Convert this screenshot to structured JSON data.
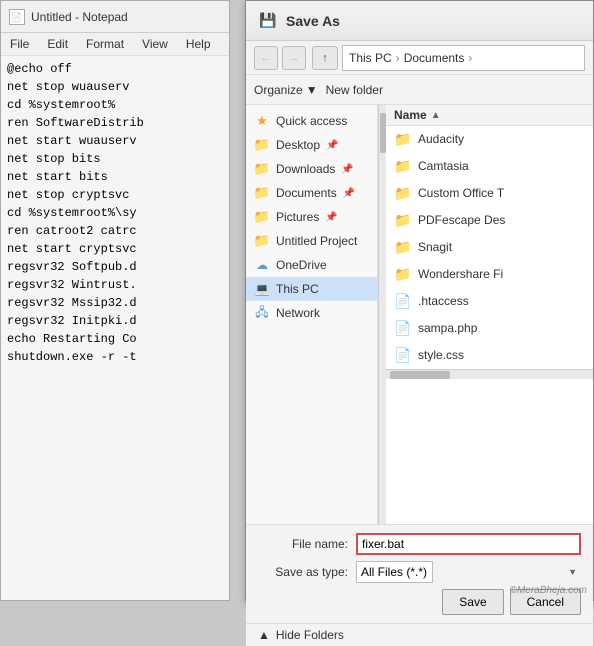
{
  "notepad": {
    "title": "Untitled - Notepad",
    "icon": "📄",
    "menus": [
      "File",
      "Edit",
      "Format",
      "View",
      "Help"
    ],
    "lines": [
      "@echo off",
      "net stop wuauserv",
      "cd %systemroot%",
      "ren SoftwareDistrib",
      "net start wuauserv",
      "net stop bits",
      "net start bits",
      "net stop cryptsvc",
      "cd %systemroot%\\sy",
      "ren catroot2 catrc",
      "net start cryptsvc",
      "regsvr32 Softpub.d",
      "regsvr32 Wintrust.",
      "regsvr32 Mssip32.d",
      "regsvr32 Initpki.d",
      "echo Restarting Co",
      "shutdown.exe -r -t"
    ]
  },
  "dialog": {
    "title": "Save As",
    "title_icon": "💾",
    "path": {
      "segments": [
        "This PC",
        "Documents"
      ]
    },
    "toolbar": {
      "organize_label": "Organize",
      "new_folder_label": "New folder"
    },
    "nav_items": [
      {
        "id": "quick-access",
        "label": "Quick access",
        "icon": "star",
        "pinned": false
      },
      {
        "id": "desktop",
        "label": "Desktop",
        "icon": "folder-blue",
        "pinned": true
      },
      {
        "id": "downloads",
        "label": "Downloads",
        "icon": "folder-blue",
        "pinned": true
      },
      {
        "id": "documents",
        "label": "Documents",
        "icon": "folder-blue",
        "pinned": true
      },
      {
        "id": "pictures",
        "label": "Pictures",
        "icon": "folder-blue",
        "pinned": true
      },
      {
        "id": "untitled",
        "label": "Untitled Project",
        "icon": "folder-orange",
        "pinned": false
      },
      {
        "id": "onedrive",
        "label": "OneDrive",
        "icon": "cloud",
        "pinned": false
      },
      {
        "id": "this-pc",
        "label": "This PC",
        "icon": "pc",
        "selected": true
      },
      {
        "id": "network",
        "label": "Network",
        "icon": "network",
        "pinned": false
      }
    ],
    "file_list": {
      "column": "Name",
      "items": [
        {
          "name": "Audacity",
          "icon": "folder",
          "color": "#e8c050"
        },
        {
          "name": "Camtasia",
          "icon": "folder",
          "color": "#e8c050"
        },
        {
          "name": "Custom Office T",
          "icon": "folder",
          "color": "#e8c050"
        },
        {
          "name": "PDFescape Des",
          "icon": "folder",
          "color": "#e8c050"
        },
        {
          "name": "Snagit",
          "icon": "folder",
          "color": "#e8c050"
        },
        {
          "name": "Wondershare Fi",
          "icon": "folder",
          "color": "#e8c050"
        },
        {
          "name": ".htaccess",
          "icon": "file",
          "color": "#fff"
        },
        {
          "name": "sampa.php",
          "icon": "file",
          "color": "#fff"
        },
        {
          "name": "style.css",
          "icon": "file",
          "color": "#fff"
        }
      ]
    },
    "form": {
      "file_name_label": "File name:",
      "file_name_value": "fixer.bat",
      "save_type_label": "Save as type:",
      "save_type_value": "All Files (*.*)",
      "save_button": "Save",
      "cancel_button": "Cancel"
    },
    "hide_folders_label": "Hide Folders",
    "watermark": "©MeraBheja.com"
  }
}
